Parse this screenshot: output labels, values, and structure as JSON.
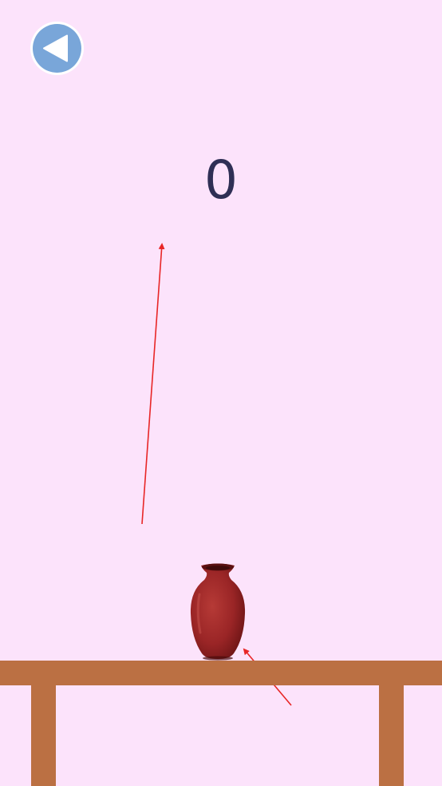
{
  "game": {
    "score": "0",
    "back_button_icon": "triangle-left-icon",
    "colors": {
      "background": "#fce3fb",
      "back_button_fill": "#79a6d9",
      "back_button_ring": "#ffffff",
      "score_text": "#2f2f55",
      "table": "#bb7043",
      "vase": "#9e2525",
      "arrow": "#e82626"
    }
  }
}
